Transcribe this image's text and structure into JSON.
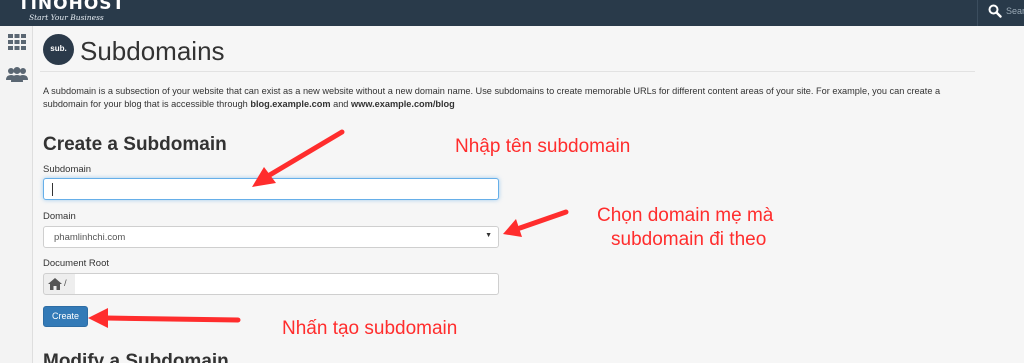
{
  "brand": {
    "name": "TINOHOST",
    "tagline": "Start Your Business"
  },
  "header": {
    "search_placeholder": "Sear"
  },
  "sidebar": {
    "icons": [
      "grid-icon",
      "users-icon"
    ]
  },
  "page": {
    "icon_label": "sub.",
    "title": "Subdomains",
    "description_intro": "A subdomain is a subsection of your website that can exist as a new website without a new domain name. Use subdomains to create memorable URLs for different content areas of your site. For example, you can create a subdomain for your blog that is accessible through ",
    "example_1": "blog.example.com",
    "description_and": " and ",
    "example_2": "www.example.com/blog"
  },
  "form": {
    "section_title": "Create a Subdomain",
    "subdomain_label": "Subdomain",
    "subdomain_value": "",
    "domain_label": "Domain",
    "domain_selected": "phamlinhchi.com",
    "document_root_label": "Document Root",
    "document_root_prefix": "/",
    "document_root_value": "",
    "create_button": "Create"
  },
  "next_section": {
    "title": "Modify a Subdomain"
  },
  "annotations": {
    "note_subdomain": "Nhập tên subdomain",
    "note_domain_line1": "Chọn domain mẹ mà",
    "note_domain_line2": "subdomain đi theo",
    "note_create": "Nhấn tạo subdomain",
    "arrow_color": "#ff2d2d"
  },
  "colors": {
    "topbar": "#293a4a",
    "primary_button": "#337ab7",
    "annotation": "#ff2d2d"
  }
}
